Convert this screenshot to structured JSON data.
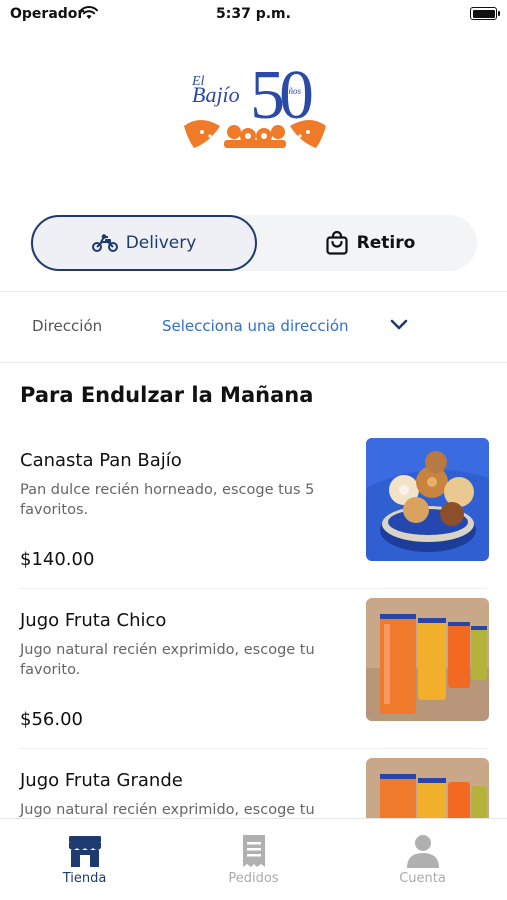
{
  "status_bar": {
    "carrier": "Operador",
    "time": "5:37 p.m."
  },
  "logo": {
    "brand_line1": "El",
    "brand_line2": "Bajío",
    "anniversary_number": "50",
    "anniversary_suffix": "años"
  },
  "mode_toggle": {
    "delivery_label": "Delivery",
    "pickup_label": "Retiro",
    "selected": "Delivery"
  },
  "address": {
    "label": "Dirección",
    "value": "Selecciona una dirección"
  },
  "section": {
    "title": "Para Endulzar la Mañana"
  },
  "products": [
    {
      "name": "Canasta Pan Bajío",
      "description": "Pan dulce recién horneado, escoge tus 5 favoritos.",
      "price": "$140.00",
      "image": "pan-dulce-basket"
    },
    {
      "name": "Jugo Fruta Chico",
      "description": "Jugo natural recién exprimido, escoge tu favorito.",
      "price": "$56.00",
      "image": "juice-glasses"
    },
    {
      "name": "Jugo Fruta Grande",
      "description": "Jugo natural recién exprimido, escoge tu",
      "price": "",
      "image": "juice-glasses"
    }
  ],
  "tab_bar": {
    "tabs": [
      {
        "label": "Tienda",
        "icon": "store-icon",
        "active": true
      },
      {
        "label": "Pedidos",
        "icon": "receipt-icon",
        "active": false
      },
      {
        "label": "Cuenta",
        "icon": "person-icon",
        "active": false
      }
    ]
  },
  "colors": {
    "primary_navy": "#1f3a6e",
    "link_blue": "#2f6fce",
    "logo_orange": "#ef7a28",
    "logo_blue": "#2b4aa8"
  }
}
